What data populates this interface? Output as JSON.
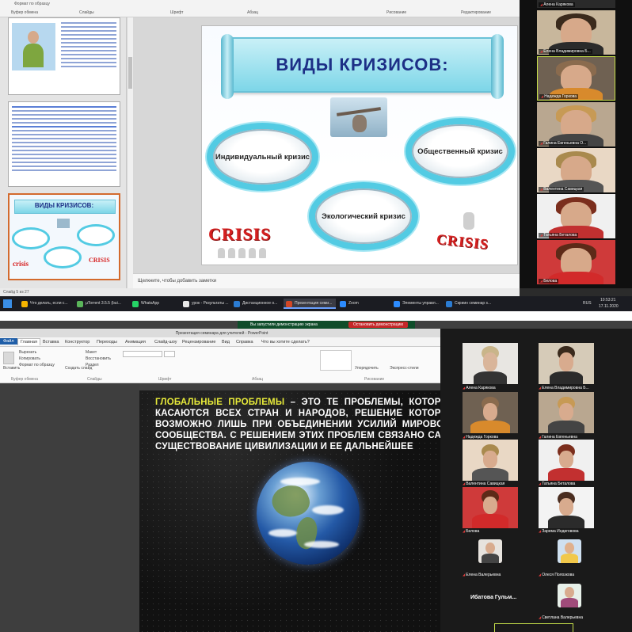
{
  "top": {
    "ribbon": {
      "labels": [
        "Буфер обмена",
        "Слайды",
        "Шрифт",
        "Абзац",
        "Рисование",
        "Редактирование"
      ],
      "btn_format": "Формат по образцу"
    },
    "slide": {
      "title": "ВИДЫ КРИЗИСОВ:",
      "ellipse_left": "Индивидуальный кризис",
      "ellipse_right": "Общественный кризис",
      "ellipse_bottom": "Экологический кризис",
      "crisis_left": "CRISIS",
      "crisis_right": "CRISIS"
    },
    "thumb3_title": "ВИДЫ КРИЗИСОВ:",
    "notes_placeholder": "Щелкните, чтобы добавить заметки",
    "status": "Слайд 5 из 27",
    "participants": [
      "Алена Карякова",
      "Елена Владимировна Б...",
      "Надежда Горкова",
      "Галина Евгеньевна О...",
      "Валентина Савицкая",
      "Татьяна Беталова",
      "Белова"
    ],
    "taskbar": {
      "items": [
        "Что делать, если с...",
        "µTorrent 3.5.5 (bui...",
        "WhatsApp",
        "урок - Результаты ...",
        "Дистанционное о...",
        "Презентация семи...",
        "Zoom",
        "Элементы управл...",
        "Скриин семинар s..."
      ],
      "clock_time": "10:53:21",
      "clock_date": "17.11.2020",
      "lang": "RUS"
    }
  },
  "bottom": {
    "share_status": "Вы запустили демонстрацию экрана",
    "stop_share": "Остановить демонстрацию",
    "window_title": "Презентация семинара для учителей - PowerPoint",
    "tabs": [
      "Файл",
      "Главная",
      "Вставка",
      "Конструктор",
      "Переходы",
      "Анимация",
      "Слайд-шоу",
      "Рецензирование",
      "Вид",
      "Справка",
      "Что вы хотите сделать?"
    ],
    "ribbon": {
      "paste": "Вставить",
      "cut": "Вырезать",
      "copy": "Копировать",
      "format": "Формат по образцу",
      "create_slide": "Создать слайд",
      "layout": "Макет",
      "reset": "Восстановить",
      "section": "Раздел",
      "arrange": "Упорядочить",
      "express": "Экспресс-стили",
      "group_clipboard": "Буфер обмена",
      "group_slides": "Слайды",
      "group_font": "Шрифт",
      "group_paragraph": "Абзац",
      "group_drawing": "Рисование"
    },
    "slide": {
      "highlight": "ГЛОБАЛЬНЫЕ ПРОБЛЕМЫ",
      "body": " – ЭТО ТЕ ПРОБЛЕМЫ, КОТОРЫЕ КАСАЮТСЯ ВСЕХ СТРАН И НАРОДОВ, РЕШЕНИЕ КОТОРЫХ ВОЗМОЖНО ЛИШЬ ПРИ ОБЪЕДИНЕНИИ УСИЛИЙ МИРОВОГО СООБЩЕСТВА. С РЕШЕНИЕМ ЭТИХ ПРОБЛЕМ СВЯЗАНО САМО СУЩЕСТВОВАНИЕ ЦИВИЛИЗАЦИИ И ЕЕ ДАЛЬНЕЙШЕЕ"
    },
    "participants": [
      "Алена Карякова",
      "Елена Владимировна Б...",
      "Надежда Горкова",
      "Галина Евгеньевна",
      "Валентина Савицкая",
      "Татьяна Беталова",
      "Белова",
      "Зарема Индиговова",
      "Елена Валерьевна",
      "Олеся Полозкова",
      "Ибатова Гульм...",
      "Светлана Валерьевна"
    ]
  }
}
